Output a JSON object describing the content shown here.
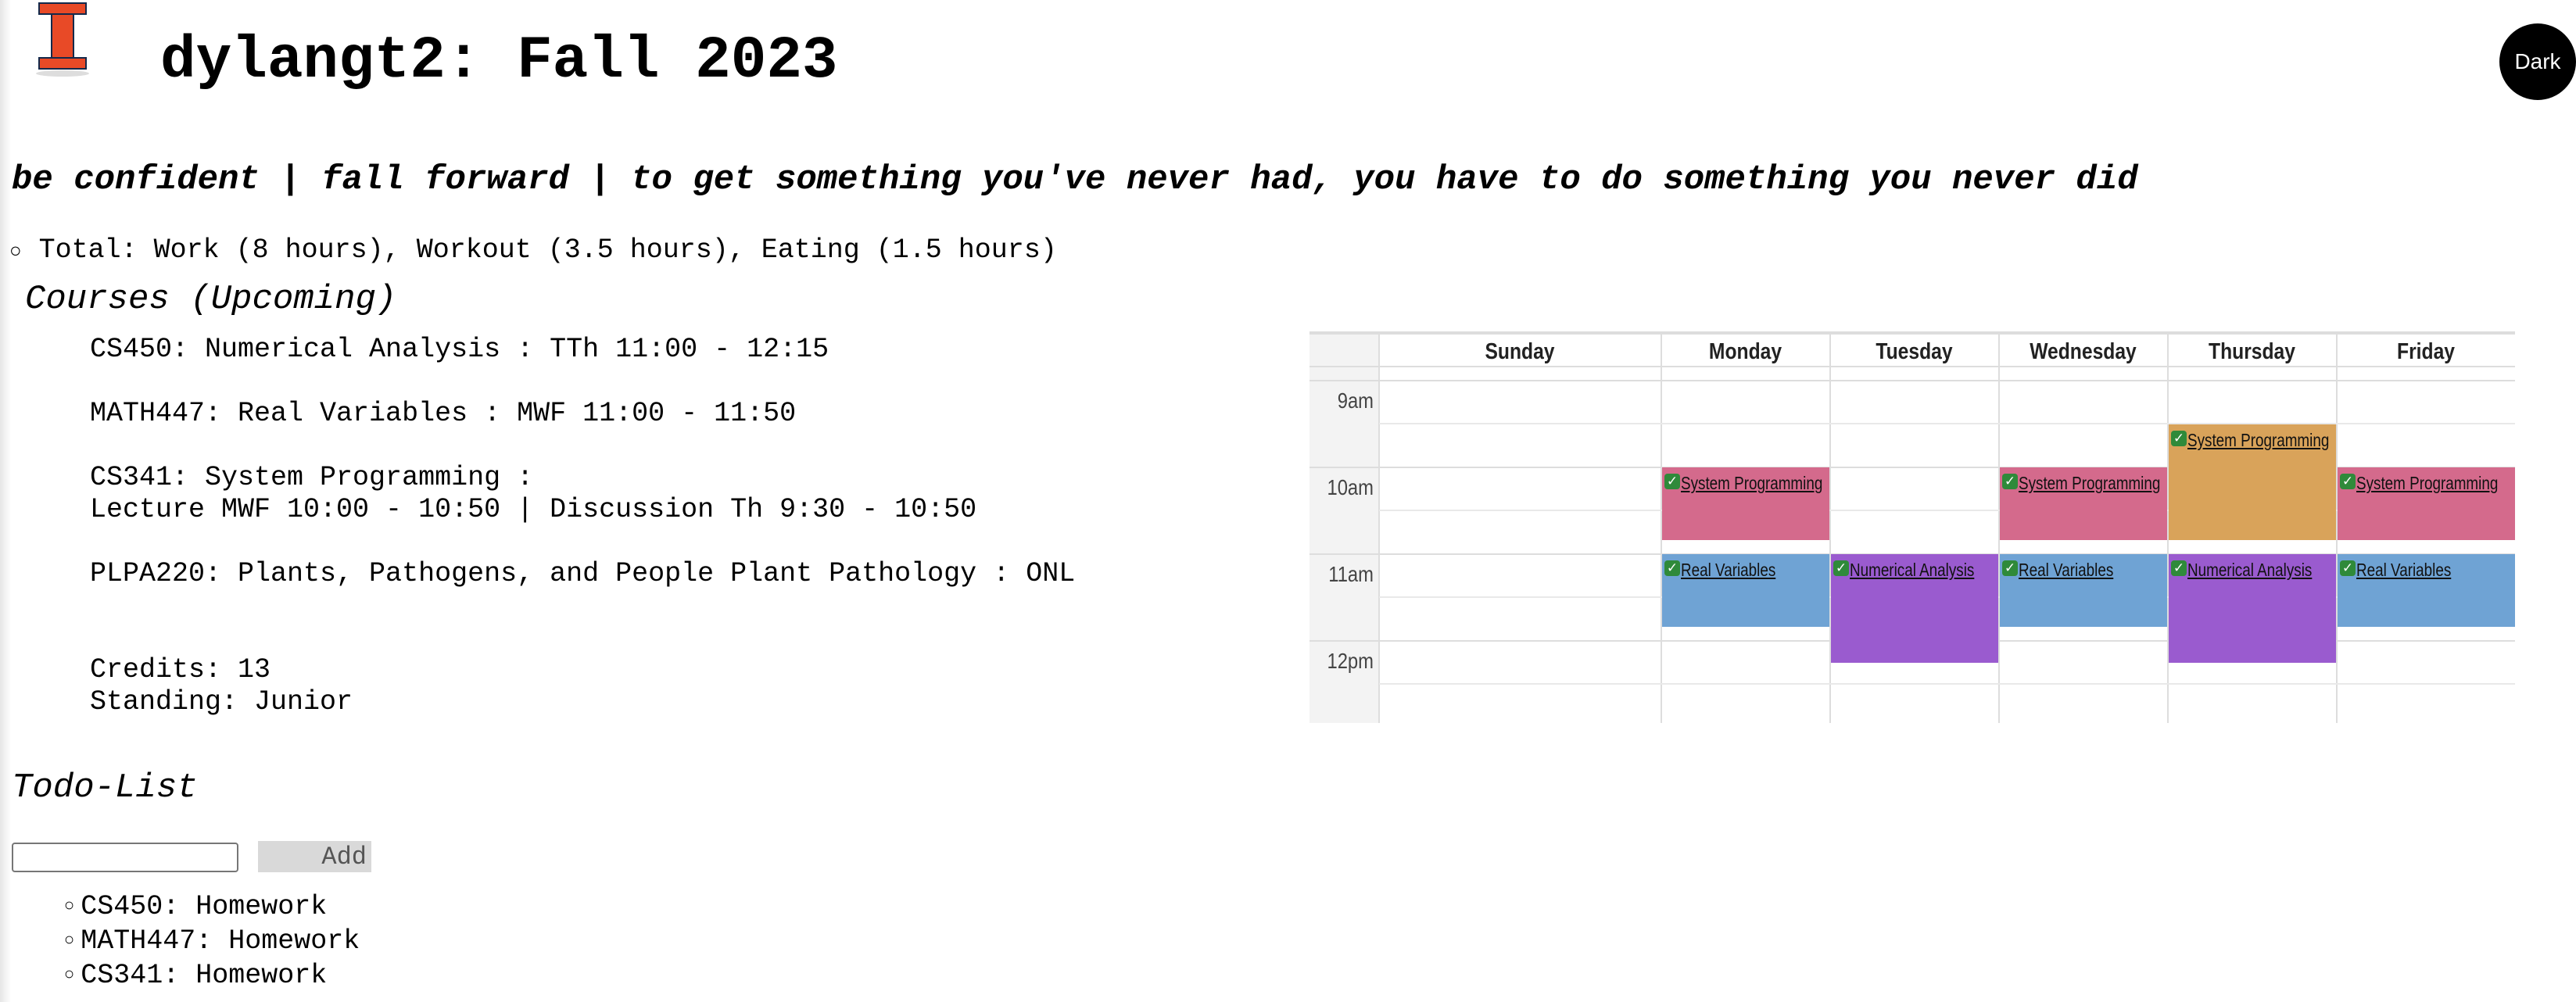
{
  "header": {
    "title": "dylangt2: Fall 2023",
    "theme_toggle_label": "Dark"
  },
  "motto": "be confident | fall forward | to get something you've never had, you have to do something you never did",
  "totals": "Total: Work (8 hours), Workout (3.5 hours), Eating (1.5 hours)",
  "courses": {
    "heading": "Courses (Upcoming)",
    "items": [
      {
        "line1": "CS450: Numerical Analysis : TTh 11:00 - 12:15"
      },
      {
        "line1": "MATH447: Real Variables : MWF 11:00 - 11:50"
      },
      {
        "line1": "CS341: System Programming :",
        "line2": "Lecture MWF 10:00 - 10:50 | Discussion Th 9:30 - 10:50"
      },
      {
        "line1": "PLPA220: Plants, Pathogens, and People Plant Pathology : ONL"
      }
    ],
    "credits": "Credits: 13",
    "standing": "Standing: Junior"
  },
  "todo": {
    "heading": "Todo-List",
    "input_value": "",
    "add_label": "Add",
    "items": [
      "CS450: Homework",
      "MATH447: Homework",
      "CS341: Homework"
    ]
  },
  "calendar": {
    "days": [
      "Sunday",
      "Monday",
      "Tuesday",
      "Wednesday",
      "Thursday",
      "Friday"
    ],
    "times": [
      "9am",
      "10am",
      "11am",
      "12pm"
    ],
    "events": [
      {
        "day": "Monday",
        "start": "10:00",
        "end": "10:50",
        "title": "System Programming",
        "color": "#d46a8c"
      },
      {
        "day": "Wednesday",
        "start": "10:00",
        "end": "10:50",
        "title": "System Programming",
        "color": "#d46a8c"
      },
      {
        "day": "Friday",
        "start": "10:00",
        "end": "10:50",
        "title": "System Programming",
        "color": "#d46a8c"
      },
      {
        "day": "Thursday",
        "start": "9:30",
        "end": "10:50",
        "title": "System Programming",
        "color": "#d9a35a"
      },
      {
        "day": "Monday",
        "start": "11:00",
        "end": "11:50",
        "title": "Real Variables",
        "color": "#6fa3d4"
      },
      {
        "day": "Wednesday",
        "start": "11:00",
        "end": "11:50",
        "title": "Real Variables",
        "color": "#6fa3d4"
      },
      {
        "day": "Friday",
        "start": "11:00",
        "end": "11:50",
        "title": "Real Variables",
        "color": "#6fa3d4"
      },
      {
        "day": "Tuesday",
        "start": "11:00",
        "end": "12:15",
        "title": "Numerical Analysis",
        "color": "#9a5bcf"
      },
      {
        "day": "Thursday",
        "start": "11:00",
        "end": "12:15",
        "title": "Numerical Analysis",
        "color": "#9a5bcf"
      }
    ]
  },
  "colors": {
    "logo_orange": "#E84A27",
    "logo_navy": "#13294B"
  }
}
